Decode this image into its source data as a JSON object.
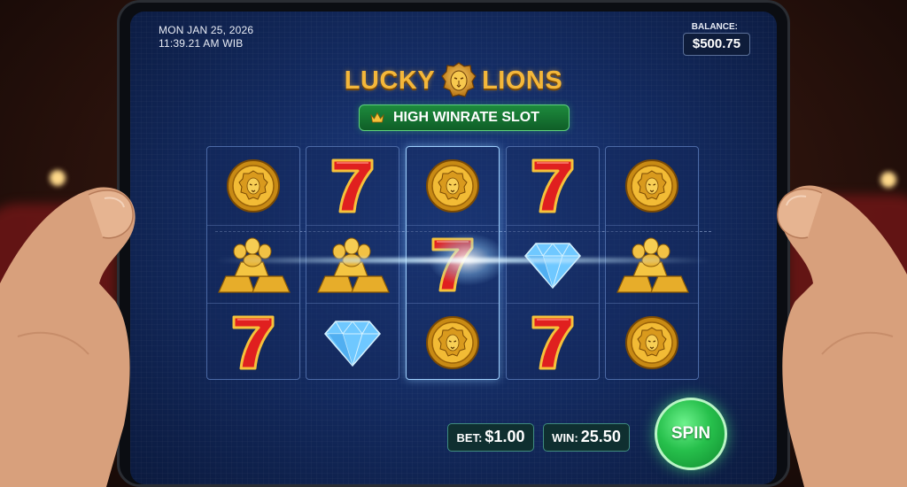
{
  "status": {
    "date": "MON JAN 25, 2026",
    "time": "11:39.21 AM WIB"
  },
  "balance": {
    "label": "BALANCE:",
    "value": "$500.75"
  },
  "title": {
    "word1": "LUCKY",
    "word2": "LIONS",
    "emblem": "lion-head-icon"
  },
  "banner": {
    "label": "HIGH WINRATE SLOT",
    "icon": "crown-icon"
  },
  "reels": [
    [
      "lion-coin",
      "gold-bars",
      "seven"
    ],
    [
      "seven",
      "gold-bars",
      "diamond"
    ],
    [
      "lion-coin",
      "seven",
      "lion-coin"
    ],
    [
      "seven",
      "diamond",
      "seven"
    ],
    [
      "lion-coin",
      "gold-bars",
      "lion-coin"
    ]
  ],
  "bet": {
    "label": "BET:",
    "value": "$1.00"
  },
  "win": {
    "label": "WIN:",
    "value": "25.50"
  },
  "spin_label": "SPIN",
  "colors": {
    "screen_bg": "#142c63",
    "gold": "#f4b73a",
    "banner_green": "#1d8b3d",
    "spin_green": "#27c04c",
    "seven_red": "#e0201f",
    "diamond_blue": "#6fc8ff"
  }
}
